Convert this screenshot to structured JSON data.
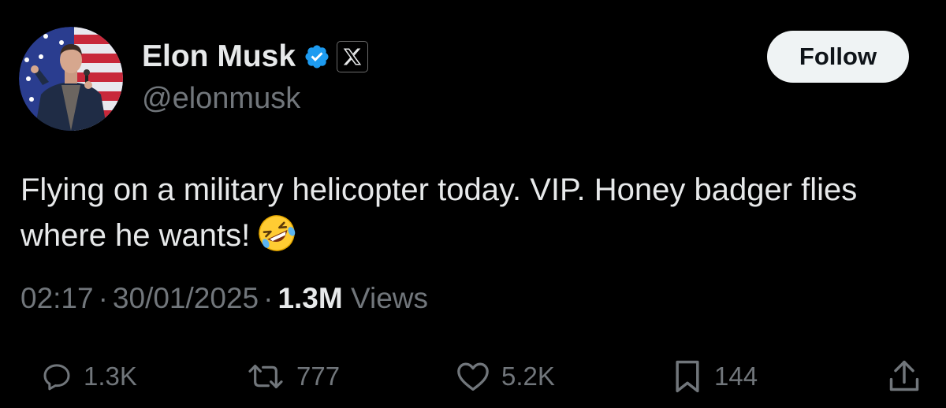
{
  "author": {
    "display_name": "Elon Musk",
    "handle": "@elonmusk",
    "verified_icon": "verified-badge-icon",
    "affiliation_icon": "x-logo-icon"
  },
  "follow_label": "Follow",
  "tweet": {
    "text": "Flying on a military helicopter today. VIP. Honey badger flies where he wants!",
    "emoji": "rolling-on-floor-laughing-emoji"
  },
  "meta": {
    "time": "02:17",
    "date": "30/01/2025",
    "separator": "·",
    "views_count": "1.3M",
    "views_label": "Views"
  },
  "actions": {
    "replies": "1.3K",
    "reposts": "777",
    "likes": "5.2K",
    "bookmarks": "144"
  },
  "colors": {
    "background": "#000000",
    "text_primary": "#e7e9ea",
    "text_secondary": "#71767b",
    "verified_blue": "#1d9bf0",
    "follow_bg": "#eff3f4"
  }
}
